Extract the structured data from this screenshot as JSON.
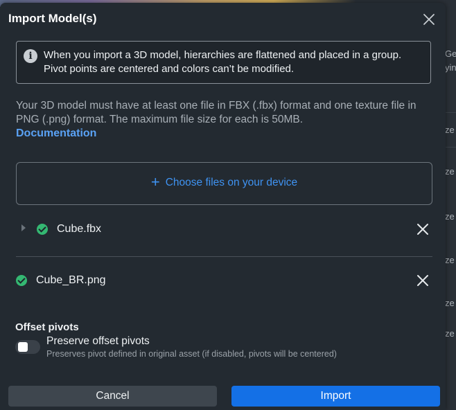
{
  "dialog": {
    "title": "Import Model(s)",
    "close_icon": "close-icon"
  },
  "info": {
    "icon": "info-icon",
    "text": "When you import a 3D model, hierarchies are flattened and placed in a group. Pivot points are centered and colors can’t be modified."
  },
  "description": "Your 3D model must have at least one file in FBX (.fbx) format and one texture file in PNG (.png) format. The maximum file size for each is 50MB.",
  "documentation_link": "Documentation",
  "dropzone": {
    "icon": "plus-icon",
    "label": "Choose files on your device"
  },
  "files": [
    {
      "name": "Cube.fbx",
      "status": "valid",
      "expandable": true
    },
    {
      "name": "Cube_BR.png",
      "status": "valid",
      "expandable": false
    }
  ],
  "offset_pivots": {
    "section_label": "Offset pivots",
    "toggle_label": "Preserve offset pivots",
    "toggle_description": "Preserves pivot defined in original asset (if disabled, pivots will be centered)",
    "enabled": false
  },
  "buttons": {
    "cancel": "Cancel",
    "import": "Import"
  },
  "background_fragments": [
    "Ge",
    "yin",
    "ze",
    "ze",
    "ze",
    "ze",
    "ze",
    "ze"
  ],
  "colors": {
    "accent": "#1470e6",
    "link": "#5aa2f5",
    "success": "#34b872",
    "dialog_bg": "#232a31"
  }
}
